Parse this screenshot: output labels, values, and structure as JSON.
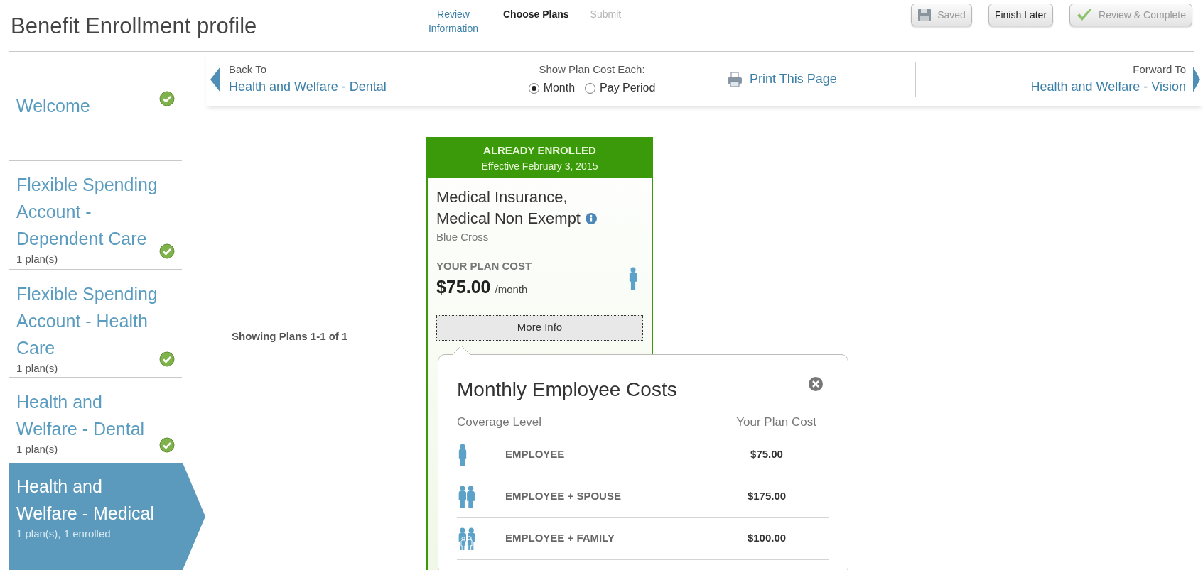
{
  "header": {
    "title": "Benefit Enrollment profile",
    "steps": [
      {
        "label": "Review Information",
        "selected": false,
        "disabled": false
      },
      {
        "label": "Choose Plans",
        "selected": true,
        "disabled": false
      },
      {
        "label": "Submit",
        "selected": false,
        "disabled": true
      }
    ],
    "buttons": [
      {
        "kind": "save",
        "label": "Saved",
        "disabled": true
      },
      {
        "kind": "plain",
        "label": "Finish Later",
        "disabled": false
      },
      {
        "kind": "complete",
        "label": "Review & Complete",
        "disabled": true
      }
    ]
  },
  "sidebar": {
    "items": [
      {
        "label": "Welcome",
        "checked": true,
        "selected": false
      },
      {
        "label": "Flexible Spending Account - Dependent Care",
        "sub": "1 plan(s)",
        "checked": true,
        "selected": false
      },
      {
        "label": "Flexible Spending Account - Health Care",
        "sub": "1 plan(s)",
        "checked": true,
        "selected": false
      },
      {
        "label": "Health and Welfare - Dental",
        "sub": "1 plan(s)",
        "checked": true,
        "selected": false
      },
      {
        "label": "Health and Welfare - Medical",
        "sub": "1 plan(s), 1 enrolled",
        "checked": false,
        "selected": true
      }
    ]
  },
  "nav": {
    "back_caption": "Back To",
    "back_link": "Health and Welfare - Dental",
    "cost_caption": "Show Plan Cost Each:",
    "cost_options": [
      {
        "label": "Month",
        "selected": true
      },
      {
        "label": "Pay Period",
        "selected": false
      }
    ],
    "print": "Print This Page",
    "forward_caption": "Forward To",
    "forward_link": "Health and Welfare - Vision"
  },
  "showing": "Showing Plans 1-1 of 1",
  "plan": {
    "status": "ALREADY ENROLLED",
    "effective": "Effective February 3, 2015",
    "name": "Medical Insurance, Medical Non Exempt",
    "carrier": "Blue Cross",
    "cost_caption": "YOUR PLAN COST",
    "cost": "$75.00",
    "period": "/month",
    "more": "More Info"
  },
  "popup": {
    "title": "Monthly Employee Costs",
    "columns": [
      "Coverage Level",
      "Your Plan Cost"
    ],
    "rows": [
      {
        "kind": "single",
        "level": "EMPLOYEE",
        "cost": "$75.00"
      },
      {
        "kind": "couple",
        "level": "EMPLOYEE + SPOUSE",
        "cost": "$175.00"
      },
      {
        "kind": "family",
        "level": "EMPLOYEE + FAMILY",
        "cost": "$100.00"
      }
    ]
  }
}
